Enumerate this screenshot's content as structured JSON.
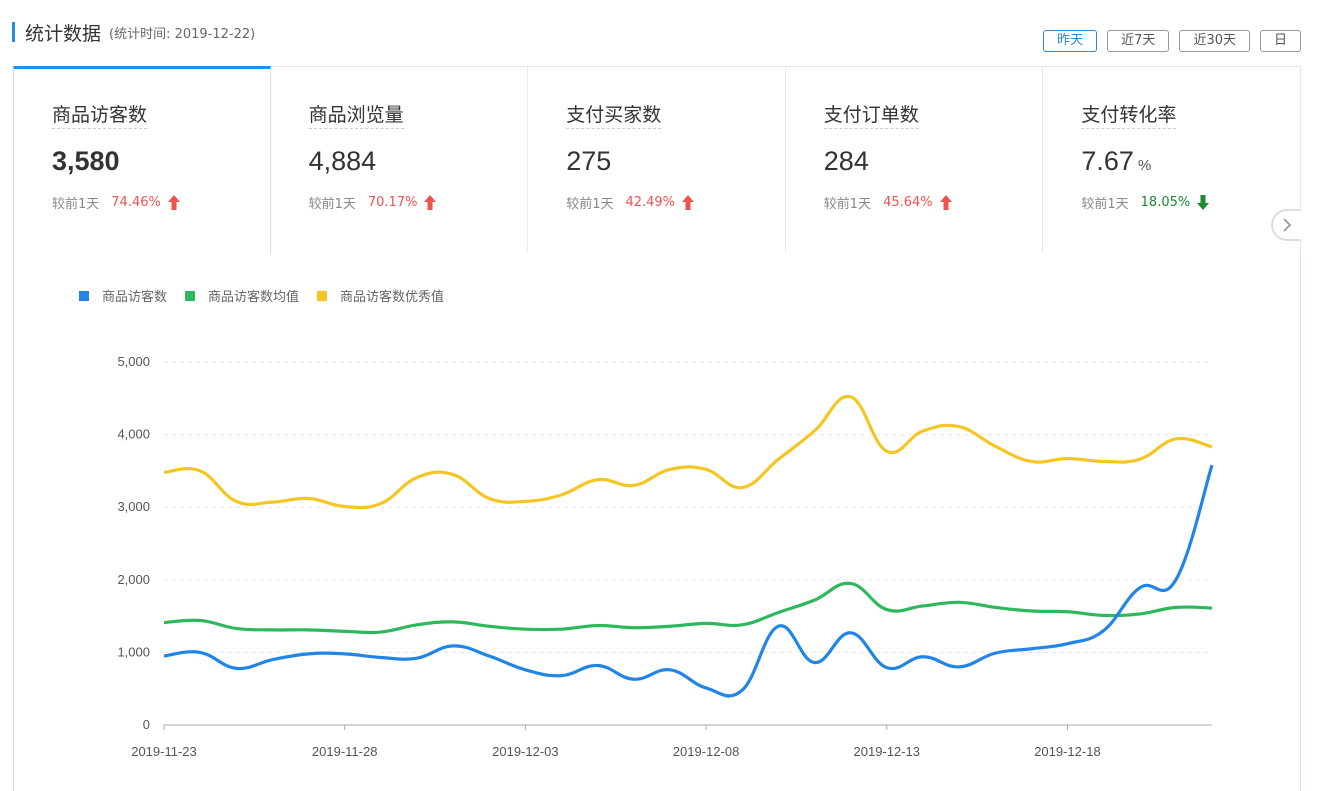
{
  "header": {
    "title": "统计数据",
    "subtitle": "(统计时间: 2019-12-22)"
  },
  "range_buttons": [
    {
      "label": "昨天",
      "active": true
    },
    {
      "label": "近7天",
      "active": false
    },
    {
      "label": "近30天",
      "active": false
    },
    {
      "label": "日",
      "active": false
    }
  ],
  "cards": [
    {
      "label": "商品访客数",
      "value": "3,580",
      "unit": "",
      "compare_label": "较前1天",
      "change": "74.46%",
      "direction": "up"
    },
    {
      "label": "商品浏览量",
      "value": "4,884",
      "unit": "",
      "compare_label": "较前1天",
      "change": "70.17%",
      "direction": "up"
    },
    {
      "label": "支付买家数",
      "value": "275",
      "unit": "",
      "compare_label": "较前1天",
      "change": "42.49%",
      "direction": "up"
    },
    {
      "label": "支付订单数",
      "value": "284",
      "unit": "",
      "compare_label": "较前1天",
      "change": "45.64%",
      "direction": "up"
    },
    {
      "label": "支付转化率",
      "value": "7.67",
      "unit": "%",
      "compare_label": "较前1天",
      "change": "18.05%",
      "direction": "down"
    }
  ],
  "icons": {
    "next": "chevron-right-icon",
    "up": "arrow-up-icon",
    "down": "arrow-down-icon"
  },
  "colors": {
    "accent": "#1e90e6",
    "up": "#ef5350",
    "down": "#1b8a2e"
  },
  "chart_data": {
    "type": "line",
    "x": [
      "2019-11-23",
      "2019-11-24",
      "2019-11-25",
      "2019-11-26",
      "2019-11-27",
      "2019-11-28",
      "2019-11-29",
      "2019-11-30",
      "2019-12-01",
      "2019-12-02",
      "2019-12-03",
      "2019-12-04",
      "2019-12-05",
      "2019-12-06",
      "2019-12-07",
      "2019-12-08",
      "2019-12-09",
      "2019-12-10",
      "2019-12-11",
      "2019-12-12",
      "2019-12-13",
      "2019-12-14",
      "2019-12-15",
      "2019-12-16",
      "2019-12-17",
      "2019-12-18",
      "2019-12-19",
      "2019-12-20",
      "2019-12-21",
      "2019-12-22"
    ],
    "xticks": [
      "2019-11-23",
      "2019-11-28",
      "2019-12-03",
      "2019-12-08",
      "2019-12-13",
      "2019-12-18"
    ],
    "ylim": [
      0,
      5000
    ],
    "yticks": [
      "0",
      "1,000",
      "2,000",
      "3,000",
      "4,000",
      "5,000"
    ],
    "grid": true,
    "legend_position": "top-left",
    "series": [
      {
        "name": "商品访客数",
        "color": "#2185e8",
        "values": [
          950,
          1000,
          780,
          900,
          980,
          980,
          930,
          920,
          1090,
          950,
          760,
          680,
          820,
          630,
          760,
          510,
          480,
          1360,
          860,
          1270,
          790,
          940,
          800,
          990,
          1050,
          1120,
          1300,
          1890,
          2000,
          3580
        ]
      },
      {
        "name": "商品访客数均值",
        "color": "#2eb85c",
        "values": [
          1410,
          1440,
          1330,
          1310,
          1310,
          1290,
          1280,
          1380,
          1420,
          1360,
          1320,
          1320,
          1370,
          1340,
          1360,
          1400,
          1380,
          1550,
          1720,
          1950,
          1590,
          1640,
          1690,
          1620,
          1570,
          1560,
          1510,
          1530,
          1620,
          1610
        ]
      },
      {
        "name": "商品访客数优秀值",
        "color": "#f5c623",
        "values": [
          3480,
          3500,
          3080,
          3070,
          3120,
          3010,
          3050,
          3410,
          3450,
          3120,
          3080,
          3170,
          3380,
          3300,
          3520,
          3520,
          3270,
          3660,
          4050,
          4520,
          3770,
          4050,
          4110,
          3840,
          3630,
          3670,
          3630,
          3660,
          3940,
          3830
        ]
      }
    ]
  }
}
